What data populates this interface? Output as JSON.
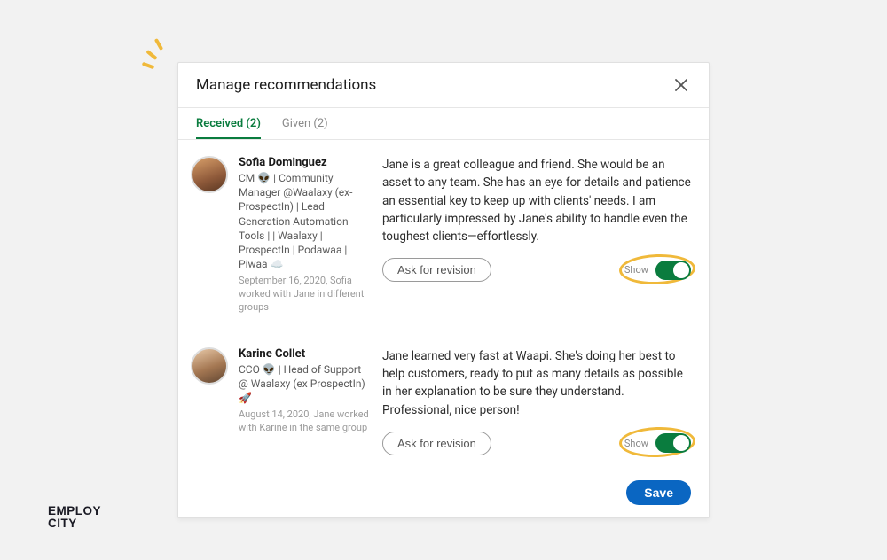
{
  "modal": {
    "title": "Manage recommendations",
    "tabs": {
      "received": "Received (2)",
      "given": "Given (2)"
    },
    "save_label": "Save"
  },
  "recommendations": [
    {
      "name": "Sofia Dominguez",
      "desc": "CM 👽 | Community Manager @Waalaxy (ex-ProspectIn) | Lead Generation Automation Tools | | Waalaxy | ProspectIn | Podawaa | Piwaa ☁️",
      "meta": "September 16, 2020, Sofia worked with Jane in different groups",
      "text": "Jane is a great colleague and friend. She would be an asset to any team. She has an eye for details and patience an essential key to keep up with clients' needs. I am particularly impressed by Jane's ability to handle even the toughest clients—effortlessly.",
      "ask_label": "Ask for revision",
      "toggle_label": "Show"
    },
    {
      "name": "Karine Collet",
      "desc": "CCO 👽 | Head of Support @ Waalaxy (ex ProspectIn) 🚀",
      "meta": "August 14, 2020, Jane worked with Karine in the same group",
      "text": "Jane learned very fast at Waapi. She's doing her best to help customers, ready to put as many details as possible in her explanation to be sure they understand. Professional, nice person!",
      "ask_label": "Ask for revision",
      "toggle_label": "Show"
    }
  ],
  "logo": {
    "line1": "EMPLOY",
    "line2": "CITY"
  }
}
